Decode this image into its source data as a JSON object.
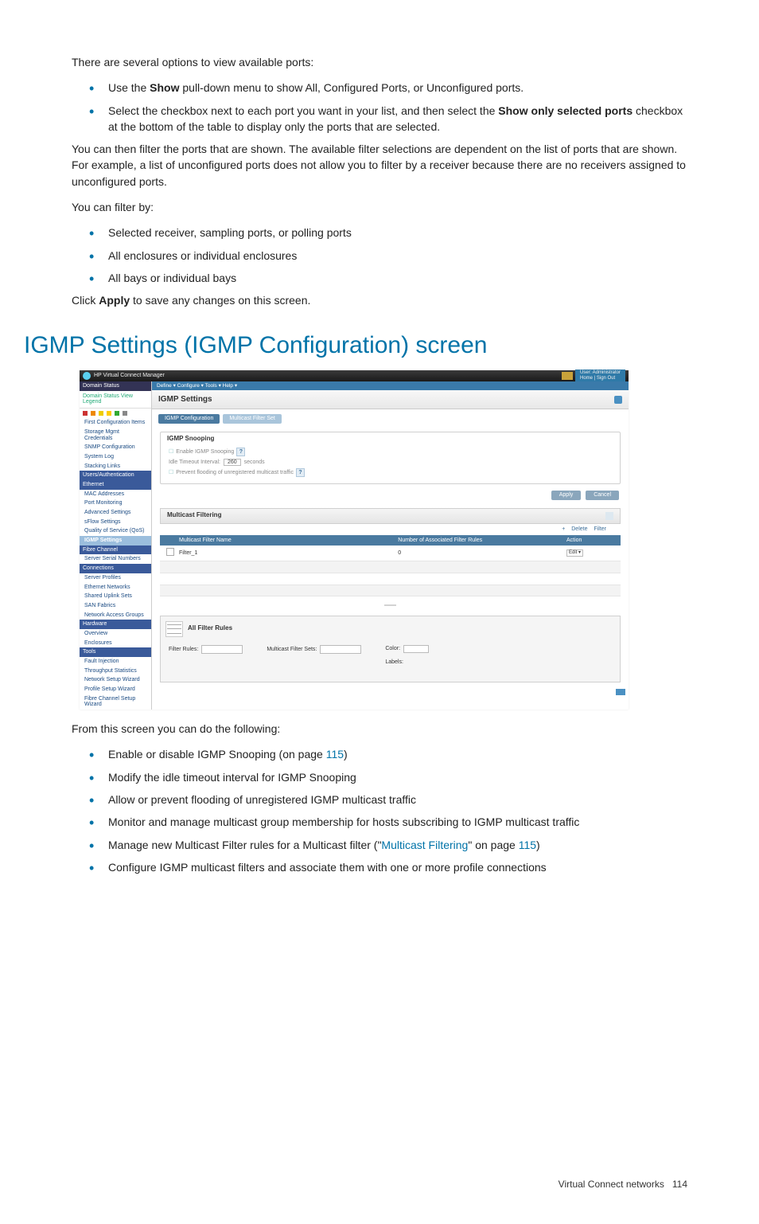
{
  "intro_p1": "There are several options to view available ports:",
  "intro_bullets_a": [
    {
      "pre": "Use the ",
      "b": "Show",
      "post": " pull-down menu to show All, Configured Ports, or Unconfigured ports."
    },
    {
      "pre": "Select the checkbox next to each port you want in your list, and then select the ",
      "b": "Show only selected ports",
      "post": " checkbox at the bottom of the table to display only the ports that are selected."
    }
  ],
  "intro_p2": "You can then filter the ports that are shown. The available filter selections are dependent on the list of ports that are shown. For example, a list of unconfigured ports does not allow you to filter by a receiver because there are no receivers assigned to unconfigured ports.",
  "intro_p3": "You can filter by:",
  "filter_bullets": [
    "Selected receiver, sampling ports, or polling ports",
    "All enclosures or individual enclosures",
    "All bays or individual bays"
  ],
  "click_apply_pre": "Click ",
  "click_apply_b": "Apply",
  "click_apply_post": " to save any changes on this screen.",
  "section_title": "IGMP Settings (IGMP Configuration) screen",
  "screenshot": {
    "topbar_title": "HP Virtual Connect Manager",
    "topbar_user": "User: Administrator",
    "topbar_links": "Home | Sign Out",
    "sidebar": {
      "domain_status": "Domain Status",
      "domain_row": "Domain Status    View Legend",
      "first_config": "First Configuration Items",
      "items1": [
        "Storage Mgmt Credentials",
        "SNMP Configuration",
        "System Log",
        "Stacking Links"
      ],
      "users_auth": "Users/Authentication",
      "ethernet": "Ethernet",
      "items2": [
        "MAC Addresses",
        "Port Monitoring",
        "Advanced Settings",
        "sFlow Settings",
        "Quality of Service (QoS)"
      ],
      "igmp": "IGMP Settings",
      "fibre": "Fibre Channel",
      "items3": [
        "Server Serial Numbers"
      ],
      "connections": "Connections",
      "items4": [
        "Server Profiles",
        "Ethernet Networks",
        "Shared Uplink Sets",
        "SAN Fabrics",
        "Network Access Groups"
      ],
      "hardware": "Hardware",
      "items5": [
        "Overview",
        "Enclosures"
      ],
      "tools": "Tools",
      "items6": [
        "Fault Injection",
        "Throughput Statistics",
        "Network Setup Wizard",
        "Profile Setup Wizard",
        "Fibre Channel Setup Wizard"
      ]
    },
    "menubar": "Define ▾    Configure ▾    Tools ▾    Help ▾",
    "main_title": "IGMP Settings",
    "tab1": "IGMP Configuration",
    "tab2": "Multicast Filter Set",
    "snoop_title": "IGMP Snooping",
    "enable_snoop": "Enable IGMP Snooping",
    "idle_timeout_lbl": "Idle Timeout Interval:",
    "idle_timeout_val": "260",
    "idle_timeout_sfx": "seconds",
    "prevent_flood": "Prevent flooding of unregistered multicast traffic",
    "btn_apply": "Apply",
    "btn_cancel": "Cancel",
    "mf_title": "Multicast Filtering",
    "toolbar_add": "+",
    "toolbar_delete": "Delete",
    "toolbar_filter": "Filter",
    "th_chk": "",
    "th_name": "Multicast Filter Name",
    "th_count": "Number of Associated Filter Rules",
    "th_action": "Action",
    "row_name": "Filter_1",
    "row_count": "0",
    "row_action": "Edit",
    "afr_title": "All Filter Rules",
    "afr_rules": "Filter Rules:",
    "afr_mfs": "Multicast Filter Sets:",
    "afr_color": "Color:",
    "afr_labels": "Labels:"
  },
  "from_screen": "From this screen you can do the following:",
  "actions": [
    {
      "parts": [
        {
          "t": "Enable or disable IGMP Snooping (on page "
        },
        {
          "link": "115"
        },
        {
          "t": ")"
        }
      ]
    },
    {
      "parts": [
        {
          "t": "Modify the idle timeout interval for IGMP Snooping"
        }
      ]
    },
    {
      "parts": [
        {
          "t": "Allow or prevent flooding of unregistered IGMP multicast traffic"
        }
      ]
    },
    {
      "parts": [
        {
          "t": "Monitor and manage multicast group membership for hosts subscribing to IGMP multicast traffic"
        }
      ]
    },
    {
      "parts": [
        {
          "t": "Manage new Multicast Filter rules for a Multicast filter (\""
        },
        {
          "link": "Multicast Filtering"
        },
        {
          "t": "\" on page "
        },
        {
          "link": "115"
        },
        {
          "t": ")"
        }
      ]
    },
    {
      "parts": [
        {
          "t": "Configure IGMP multicast filters and associate them with one or more profile connections"
        }
      ]
    }
  ],
  "footer_text": "Virtual Connect networks",
  "footer_page": "114"
}
